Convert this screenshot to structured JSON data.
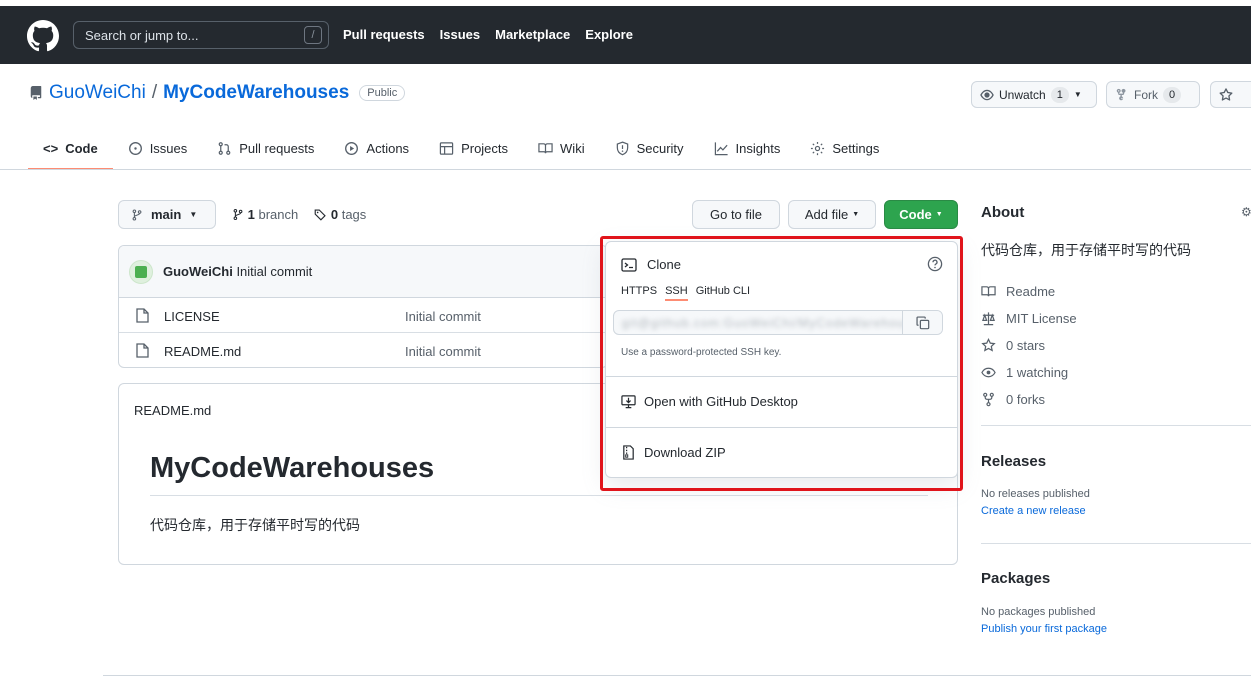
{
  "header": {
    "search_placeholder": "Search or jump to...",
    "slash_hint": "/",
    "nav": [
      "Pull requests",
      "Issues",
      "Marketplace",
      "Explore"
    ]
  },
  "repo": {
    "owner": "GuoWeiChi",
    "separator": "/",
    "name": "MyCodeWarehouses",
    "visibility": "Public",
    "watch_label": "Unwatch",
    "watch_count": "1",
    "fork_label": "Fork",
    "fork_count": "0"
  },
  "tabs": [
    "Code",
    "Issues",
    "Pull requests",
    "Actions",
    "Projects",
    "Wiki",
    "Security",
    "Insights",
    "Settings"
  ],
  "branch": {
    "current": "main",
    "branch_count": "1",
    "branch_word": "branch",
    "tag_count": "0",
    "tag_word": "tags",
    "go_to_file": "Go to file",
    "add_file": "Add file",
    "code": "Code"
  },
  "commit": {
    "author": "GuoWeiChi",
    "message": "Initial commit"
  },
  "files": [
    {
      "name": "LICENSE",
      "message": "Initial commit"
    },
    {
      "name": "README.md",
      "message": "Initial commit"
    }
  ],
  "readme": {
    "label": "README.md",
    "heading": "MyCodeWarehouses",
    "body": "代码仓库，用于存储平时写的代码"
  },
  "clone_panel": {
    "title": "Clone",
    "tabs": [
      "HTTPS",
      "SSH",
      "GitHub CLI"
    ],
    "active_tab": "SSH",
    "url_value": "git@github.com:GuoWeiChi/MyCodeWarehouses.git",
    "hint": "Use a password-protected SSH key.",
    "open_desktop": "Open with GitHub Desktop",
    "download_zip": "Download ZIP",
    "highlight_color": "#e0141b"
  },
  "about": {
    "title": "About",
    "description": "代码仓库，用于存储平时写的代码",
    "items": [
      {
        "icon": "book-icon",
        "label": "Readme"
      },
      {
        "icon": "law-icon",
        "label": "MIT License"
      },
      {
        "icon": "star-icon",
        "label": "0 stars"
      },
      {
        "icon": "eye-icon",
        "label": "1 watching"
      },
      {
        "icon": "fork-icon",
        "label": "0 forks"
      }
    ]
  },
  "releases": {
    "title": "Releases",
    "empty": "No releases published",
    "link": "Create a new release"
  },
  "packages": {
    "title": "Packages",
    "empty": "No packages published",
    "link": "Publish your first package"
  },
  "colors": {
    "header_bg": "#24292f",
    "link": "#0969da",
    "primary_button": "#2da44e",
    "active_tab_underline": "#fd8c73"
  }
}
